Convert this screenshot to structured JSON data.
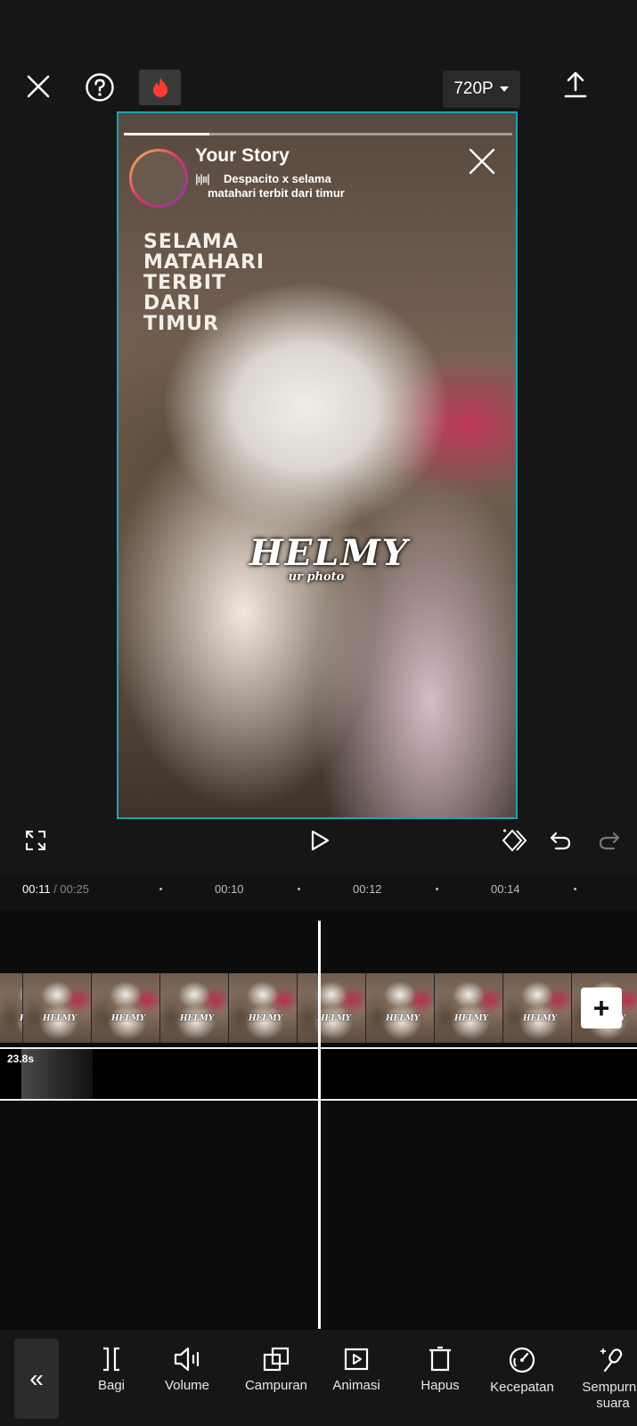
{
  "header": {
    "close_icon": "close-icon",
    "help_icon": "help-icon",
    "flame_icon": "flame-icon",
    "resolution": "720P",
    "export_icon": "export-icon"
  },
  "preview": {
    "story_title": "Your Story",
    "song_line1": "Despacito x selama",
    "song_line2": "matahari terbit dari timur",
    "lyrics": [
      "SELAMA",
      "MATAHARI",
      "TERBIT",
      "DARI",
      "TIMUR"
    ],
    "watermark": "HELMY",
    "watermark_sub": "ur photo",
    "story_progress": 0.22
  },
  "controls": {
    "fullscreen_icon": "fullscreen-icon",
    "play_icon": "play-icon",
    "keyframe_icon": "keyframe-icon",
    "undo_icon": "undo-icon",
    "redo_icon": "redo-icon"
  },
  "timeline": {
    "current_time": "00:11",
    "total_time": "/ 00:25",
    "ticks": [
      "00:10",
      "00:12",
      "00:14"
    ],
    "audio_duration": "23.8s",
    "add_label": "+"
  },
  "toolbar": {
    "collapse": "«",
    "items": [
      {
        "label": "Bagi",
        "icon": "split-icon"
      },
      {
        "label": "Volume",
        "icon": "volume-icon"
      },
      {
        "label": "Campuran",
        "icon": "blend-icon"
      },
      {
        "label": "Animasi",
        "icon": "animation-icon"
      },
      {
        "label": "Hapus",
        "icon": "delete-icon"
      },
      {
        "label": "Kecepatan",
        "icon": "speed-icon"
      },
      {
        "label": "Sempurna suara",
        "label_line1": "Sempurna",
        "label_line2": "suara",
        "icon": "voice-enhance-icon"
      }
    ]
  },
  "colors": {
    "background": "#121212",
    "accent_border": "#1aa5b5",
    "flame": "#ff3b30"
  }
}
